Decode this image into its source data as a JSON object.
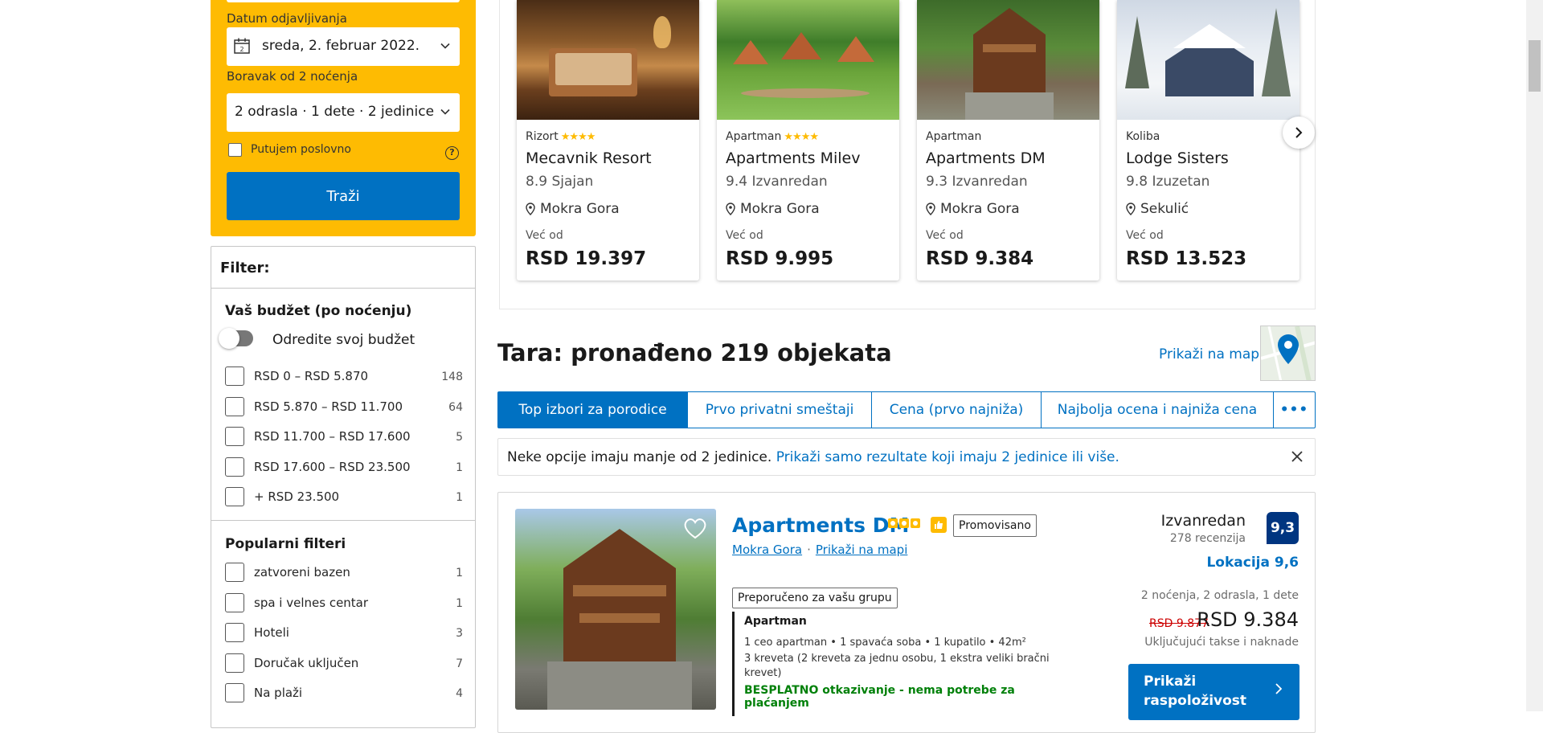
{
  "search": {
    "checkout_label": "Datum odjavljivanja",
    "checkout_value": "sreda, 2. februar 2022.",
    "stay_label": "Boravak od 2 noćenja",
    "guests_value": "2 odrasla · 1 dete · 2 jedinice",
    "business_label": "Putujem poslovno",
    "search_button": "Traži",
    "calendar_day": "2"
  },
  "filters": {
    "header": "Filter:",
    "budget_title": "Vaš budžet (po noćenju)",
    "budget_toggle": "Odredite svoj budžet",
    "budget_options": [
      {
        "label": "RSD 0 – RSD 5.870",
        "count": "148"
      },
      {
        "label": "RSD 5.870 – RSD 11.700",
        "count": "64"
      },
      {
        "label": "RSD 11.700 – RSD 17.600",
        "count": "5"
      },
      {
        "label": "RSD 17.600 – RSD 23.500",
        "count": "1"
      },
      {
        "label": "+ RSD 23.500",
        "count": "1"
      }
    ],
    "popular_title": "Popularni filteri",
    "popular_options": [
      {
        "label": "zatvoreni bazen",
        "count": "1"
      },
      {
        "label": "spa i velnes centar",
        "count": "1"
      },
      {
        "label": "Hoteli",
        "count": "3"
      },
      {
        "label": "Doručak uključen",
        "count": "7"
      },
      {
        "label": "Na plaži",
        "count": "4"
      }
    ]
  },
  "carousel": {
    "cards": [
      {
        "type": "Rizort",
        "stars": "★★★★",
        "name": "Mecavnik Resort",
        "score": "8.9 Sjajan",
        "location": "Mokra Gora",
        "from": "Već od",
        "price": "RSD 19.397"
      },
      {
        "type": "Apartman",
        "stars": "★★★★",
        "name": "Apartments Milev",
        "score": "9.4 Izvanredan",
        "location": "Mokra Gora",
        "from": "Već od",
        "price": "RSD 9.995"
      },
      {
        "type": "Apartman",
        "stars": "",
        "name": "Apartments DM",
        "score": "9.3 Izvanredan",
        "location": "Mokra Gora",
        "from": "Već od",
        "price": "RSD 9.384"
      },
      {
        "type": "Koliba",
        "stars": "",
        "name": "Lodge Sisters",
        "score": "9.8 Izuzetan",
        "location": "Sekulić",
        "from": "Već od",
        "price": "RSD 13.523"
      }
    ]
  },
  "results": {
    "title": "Tara: pronađeno 219 objekata",
    "map_link": "Prikaži na mapi"
  },
  "sort_tabs": [
    {
      "label": "Top izbori za porodice"
    },
    {
      "label": "Prvo privatni smeštaji"
    },
    {
      "label": "Cena (prvo najniža)"
    },
    {
      "label": "Najbolja ocena i najniža cena"
    },
    {
      "label": "•••"
    }
  ],
  "notice": {
    "text": "Neke opcije imaju manje od 2 jedinice.",
    "link": "Prikaži samo rezultate koji imaju 2 jedinice ili više."
  },
  "property": {
    "name": "Apartments DM",
    "promo": "Promovisano",
    "location_link": "Mokra Gora",
    "map_link": "Prikaži na mapi",
    "recommended": "Preporučeno za vašu grupu",
    "unit_name": "Apartman",
    "unit_details": "1 ceo apartman • 1 spavaća soba • 1 kupatilo • 42m²",
    "beds": "3 kreveta (2 kreveta za jednu osobu, 1 ekstra veliki bračni krevet)",
    "free_cancel": "BESPLATNO otkazivanje - nema potrebe za plaćanjem",
    "rating_word": "Izvanredan",
    "rating_count": "278 recenzija",
    "rating_score": "9,3",
    "location_score": "Lokacija 9,6",
    "nights_guests": "2 noćenja, 2 odrasla, 1 dete",
    "old_price": "RSD 9.877",
    "new_price": "RSD 9.384",
    "taxes": "Uključujući takse i naknade",
    "availability_button": "Prikaži raspoloživost"
  },
  "colors": {
    "brand_blue": "#0071c2",
    "search_yellow": "#febb02",
    "rating_navy": "#003580",
    "green": "#008009"
  }
}
